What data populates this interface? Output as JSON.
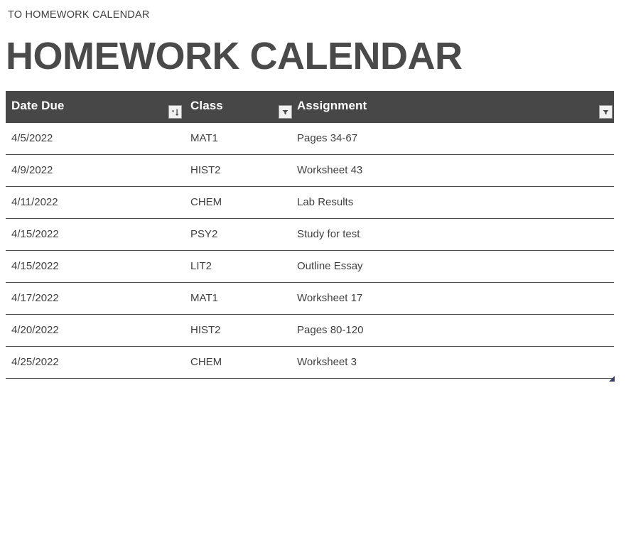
{
  "breadcrumb": {
    "label": "TO HOMEWORK CALENDAR"
  },
  "title": "HOMEWORK CALENDAR",
  "table": {
    "columns": [
      {
        "label": "Date Due",
        "filter_icon": "sort-ascending-filter-icon"
      },
      {
        "label": "Class",
        "filter_icon": "filter-dropdown-icon"
      },
      {
        "label": "Assignment",
        "filter_icon": "filter-dropdown-icon"
      }
    ],
    "rows": [
      {
        "date": "4/5/2022",
        "class": "MAT1",
        "assignment": "Pages 34-67"
      },
      {
        "date": "4/9/2022",
        "class": "HIST2",
        "assignment": "Worksheet 43"
      },
      {
        "date": "4/11/2022",
        "class": "CHEM",
        "assignment": "Lab Results"
      },
      {
        "date": "4/15/2022",
        "class": "PSY2",
        "assignment": "Study for test"
      },
      {
        "date": "4/15/2022",
        "class": "LIT2",
        "assignment": "Outline Essay"
      },
      {
        "date": "4/17/2022",
        "class": "MAT1",
        "assignment": "Worksheet 17"
      },
      {
        "date": "4/20/2022",
        "class": "HIST2",
        "assignment": "Pages 80-120"
      },
      {
        "date": "4/25/2022",
        "class": "CHEM",
        "assignment": "Worksheet 3"
      }
    ],
    "resize_handle": "table-resize-handle"
  },
  "colors": {
    "header_background": "#474747",
    "header_text": "#ffffff",
    "body_text": "#3f3f3f",
    "title_text": "#4a4a4a",
    "row_border": "#4a4a4a",
    "resize_handle": "#3b3b6e",
    "page_background": "#ffffff"
  }
}
